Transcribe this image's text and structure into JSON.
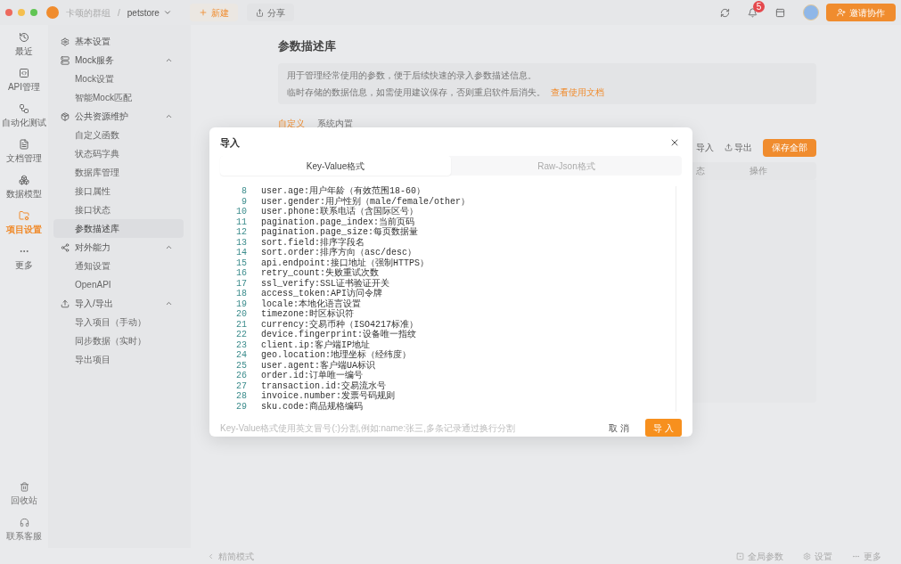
{
  "top_bar": {
    "team": "卡颂的群组",
    "separator": "/",
    "project": "petstore",
    "new_button": "新建",
    "share_button": "分享",
    "notification_badge": "5",
    "invite_button": "邀请协作"
  },
  "rail": {
    "items": [
      {
        "label": "最近",
        "selected": false
      },
      {
        "label": "API管理",
        "selected": false
      },
      {
        "label": "自动化测试",
        "selected": false
      },
      {
        "label": "文档管理",
        "selected": false
      },
      {
        "label": "数据模型",
        "selected": false
      },
      {
        "label": "项目设置",
        "selected": true
      },
      {
        "label": "更多",
        "selected": false
      }
    ],
    "bottom_items": [
      "回收站",
      "联系客服"
    ]
  },
  "sidebar": {
    "groups": [
      {
        "label": "基本设置"
      },
      {
        "label": "Mock服务",
        "expanded": true,
        "children": [
          {
            "label": "Mock设置",
            "selected": false
          },
          {
            "label": "智能Mock匹配",
            "selected": false
          }
        ]
      },
      {
        "label": "公共资源维护",
        "expanded": true,
        "children": [
          {
            "label": "自定义函数",
            "selected": false
          },
          {
            "label": "状态码字典",
            "selected": false
          },
          {
            "label": "数据库管理",
            "selected": false
          },
          {
            "label": "接口属性",
            "selected": false
          },
          {
            "label": "接口状态",
            "selected": false
          },
          {
            "label": "参数描述库",
            "selected": true
          }
        ]
      },
      {
        "label": "对外能力",
        "expanded": true,
        "children": [
          {
            "label": "通知设置",
            "selected": false
          },
          {
            "label": "OpenAPI",
            "selected": false
          }
        ]
      },
      {
        "label": "导入/导出",
        "expanded": true,
        "children": [
          {
            "label": "导入项目（手动）",
            "selected": false
          },
          {
            "label": "同步数据（实时）",
            "selected": false
          },
          {
            "label": "导出项目",
            "selected": false
          }
        ]
      }
    ]
  },
  "page": {
    "title": "参数描述库",
    "info_lines": [
      "用于管理经常使用的参数，便于后续快速的录入参数描述信息。",
      "临时存储的数据信息，如需使用建议保存，否则重启软件后消失。"
    ],
    "info_link": "查看使用文档",
    "tabs": [
      {
        "label": "自定义",
        "selected": true
      },
      {
        "label": "系统内置",
        "selected": false
      }
    ],
    "actions": [
      {
        "label": "导入",
        "kind": "import"
      },
      {
        "label": "导出",
        "kind": "export"
      },
      {
        "label": "保存全部",
        "kind": "primary"
      }
    ],
    "table_header": [
      "态",
      "操作"
    ]
  },
  "dialog": {
    "title": "导入",
    "tabs": [
      {
        "label": "Key-Value格式",
        "selected": true
      },
      {
        "label": "Raw-Json格式",
        "selected": false
      }
    ],
    "editor_lines": [
      {
        "number": "8",
        "text": "user.age:用户年龄（有效范围18-60）"
      },
      {
        "number": "9",
        "text": "user.gender:用户性别（male/female/other）"
      },
      {
        "number": "10",
        "text": "user.phone:联系电话（含国际区号）"
      },
      {
        "number": "11",
        "text": "pagination.page_index:当前页码"
      },
      {
        "number": "12",
        "text": "pagination.page_size:每页数据量"
      },
      {
        "number": "13",
        "text": "sort.field:排序字段名"
      },
      {
        "number": "14",
        "text": "sort.order:排序方向（asc/desc）"
      },
      {
        "number": "15",
        "text": "api.endpoint:接口地址（强制HTTPS）"
      },
      {
        "number": "16",
        "text": "retry_count:失败重试次数"
      },
      {
        "number": "17",
        "text": "ssl_verify:SSL证书验证开关"
      },
      {
        "number": "18",
        "text": "access_token:API访问令牌"
      },
      {
        "number": "19",
        "text": "locale:本地化语言设置"
      },
      {
        "number": "20",
        "text": "timezone:时区标识符"
      },
      {
        "number": "21",
        "text": "currency:交易币种（ISO4217标准）"
      },
      {
        "number": "22",
        "text": "device.fingerprint:设备唯一指纹"
      },
      {
        "number": "23",
        "text": "client.ip:客户端IP地址"
      },
      {
        "number": "24",
        "text": "geo.location:地理坐标（经纬度）"
      },
      {
        "number": "25",
        "text": "user.agent:客户端UA标识"
      },
      {
        "number": "26",
        "text": "order.id:订单唯一编号"
      },
      {
        "number": "27",
        "text": "transaction.id:交易流水号"
      },
      {
        "number": "28",
        "text": "invoice.number:发票号码规则"
      },
      {
        "number": "29",
        "text": "sku.code:商品规格编码"
      }
    ],
    "hint": "Key-Value格式使用英文冒号(:)分割,例如:name:张三,多条记录通过换行分割",
    "buttons": [
      {
        "label": "取 消",
        "kind": "text"
      },
      {
        "label": "导 入",
        "kind": "primary"
      }
    ]
  },
  "status_bar": {
    "left": "精简模式",
    "items": [
      "全局参数",
      "设置",
      "更多"
    ]
  }
}
